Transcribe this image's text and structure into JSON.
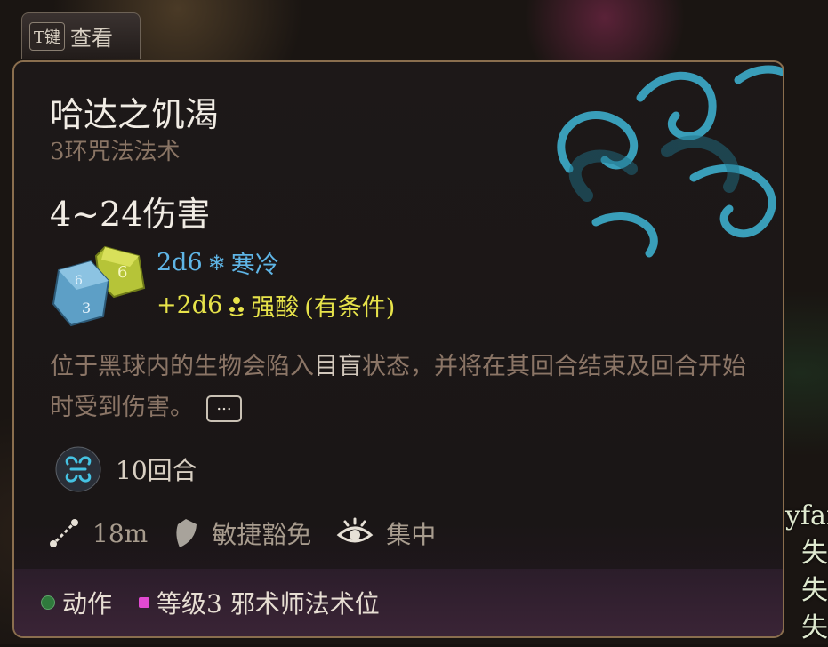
{
  "tab": {
    "key_label": "T键",
    "label": "查看"
  },
  "spell": {
    "name": "哈达之饥渴",
    "level_school": "3环咒法法术",
    "damage_range": "4~24伤害",
    "damage": [
      {
        "dice": "2d6",
        "icon": "snowflake-icon",
        "type": "寒冷",
        "color": "#5fb5e6"
      },
      {
        "dice": "+2d6",
        "icon": "acid-icon",
        "type": "强酸",
        "condition": "(有条件)",
        "color": "#e7e34a"
      }
    ],
    "description": {
      "before": "位于黑球内的生物会陷入",
      "highlight": "目盲",
      "after": "状态，并将在其回合结束及回合开始时受到伤害。",
      "more_label": "..."
    },
    "duration": "10回合",
    "range": "18m",
    "save": "敏捷豁免",
    "concentration": "集中"
  },
  "footer": {
    "action": "动作",
    "slot": "等级3 邪术师法术位"
  },
  "background_text": [
    "yfar",
    "失",
    "失",
    "失"
  ]
}
